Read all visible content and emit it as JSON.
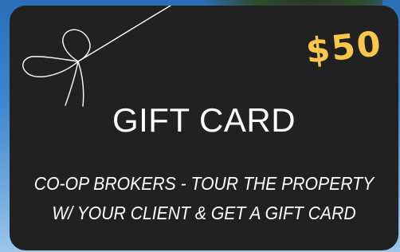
{
  "gift_card": {
    "amount": "$50",
    "title": "GIFT CARD",
    "subtitle_line1": "CO-OP BROKERS - TOUR THE PROPERTY",
    "subtitle_line2": "W/ YOUR CLIENT & GET A GIFT CARD"
  },
  "colors": {
    "card_background": "#212121",
    "amount": "#f7c64a",
    "text": "#ffffff",
    "sky_background": "#3c86cf"
  },
  "icons": [
    "ribbon-bow-icon"
  ]
}
